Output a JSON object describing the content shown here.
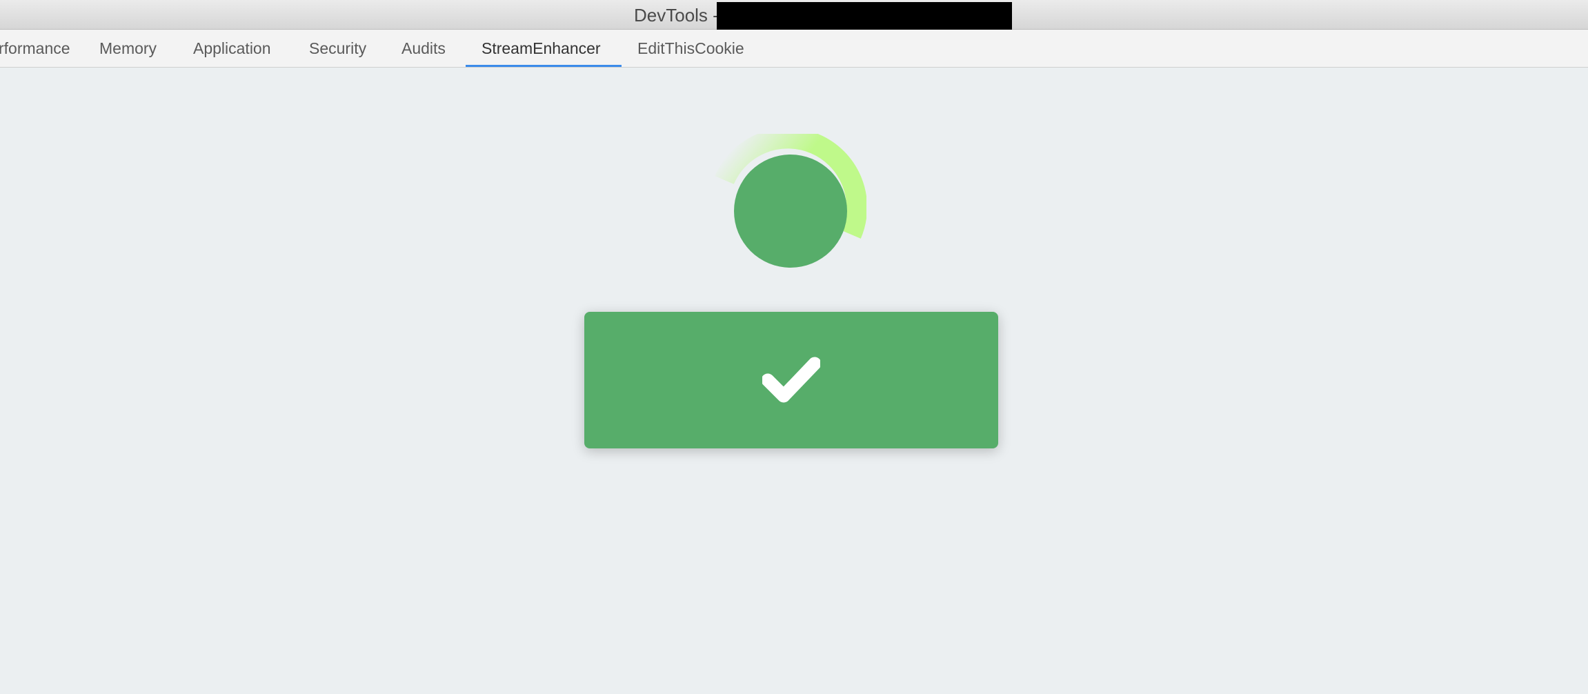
{
  "window": {
    "title": "DevTools -"
  },
  "tabs": [
    {
      "label": "rformance",
      "active": false
    },
    {
      "label": "Memory",
      "active": false
    },
    {
      "label": "Application",
      "active": false
    },
    {
      "label": "Security",
      "active": false
    },
    {
      "label": "Audits",
      "active": false
    },
    {
      "label": "StreamEnhancer",
      "active": true
    },
    {
      "label": "EditThisCookie",
      "active": false
    }
  ],
  "panel": {
    "spinner_icon": "loading-ring-icon",
    "confirm_button_icon": "checkmark-icon"
  },
  "colors": {
    "accent_green": "#57ad6a",
    "spinner_arc": "#bff98a",
    "active_tab_underline": "#3b8bea",
    "panel_background": "#ebeff1"
  }
}
